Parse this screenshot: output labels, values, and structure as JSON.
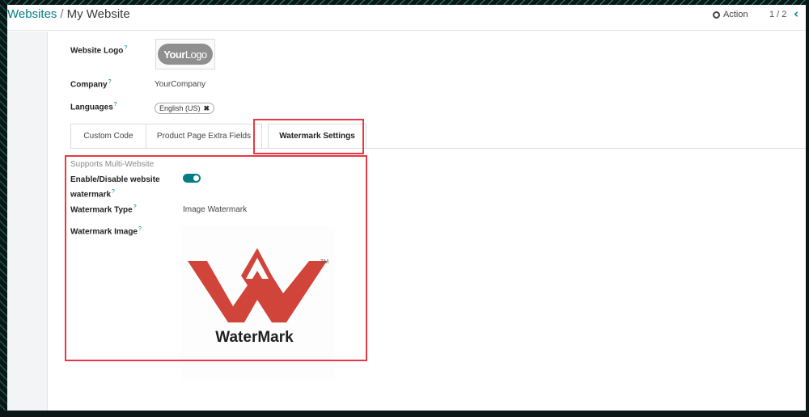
{
  "breadcrumb": {
    "parent": "Websites",
    "separator": "/",
    "current": "My Website"
  },
  "header": {
    "action_label": "Action",
    "pager": "1 / 2",
    "prev_icon": "‹"
  },
  "fields": {
    "website_logo": {
      "label": "Website Logo",
      "help": "?",
      "logo_bold": "Your",
      "logo_rest": "Logo"
    },
    "company": {
      "label": "Company",
      "help": "?",
      "value": "YourCompany"
    },
    "languages": {
      "label": "Languages",
      "help": "?",
      "tag": "English (US)",
      "remove": "✖"
    }
  },
  "tabs": [
    {
      "label": "Custom Code",
      "active": false
    },
    {
      "label": "Product Page Extra Fields",
      "active": false
    },
    {
      "label": "Watermark Settings",
      "active": true
    }
  ],
  "watermark": {
    "section_title": "Supports Multi-Website",
    "enable_label_line1": "Enable/Disable website",
    "enable_label_line2": "watermark",
    "enable_value": true,
    "type_label": "Watermark Type",
    "type_value": "Image Watermark",
    "image_label": "Watermark Image",
    "image_caption": "WaterMark",
    "image_tm": "TM",
    "help": "?"
  },
  "colors": {
    "accent": "#017e84",
    "highlight": "#e63946",
    "watermark_red": "#d0443a"
  }
}
